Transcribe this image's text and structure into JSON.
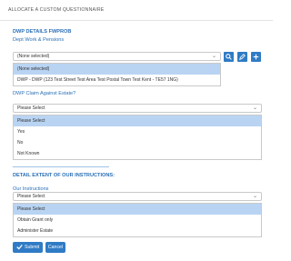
{
  "header": {
    "title": "ALLOCATE A CUSTOM QUESTIONNAIRE"
  },
  "dwp_details": {
    "title": "DWP DETAILS FWPROB",
    "label": "Dept Work & Pensions",
    "selected": "(None selected)",
    "options": [
      "(None selected)",
      "DWP - DWP (123 Test Street Test Area Test Postal Town Test Kent - TE57 1NG)"
    ],
    "actions": [
      "search-icon",
      "pencil-icon",
      "plus-icon"
    ]
  },
  "claim_against_estate": {
    "label": "DWP Claim Against Estate?",
    "selected": "Please Select",
    "options": [
      "Please Select",
      "Yes",
      "No",
      "Not Known"
    ]
  },
  "instructions": {
    "title": "DETAIL EXTENT OF OUR INSTRUCTIONS:",
    "label": "Our Instructions",
    "selected": "Please Select",
    "options": [
      "Please Select",
      "Obtain Grant only",
      "Administer Estate"
    ]
  },
  "buttons": {
    "submit": "Submit",
    "cancel": "Cancel"
  },
  "colors": {
    "accent": "#2f7bc5",
    "label": "#2a6fb6",
    "selected_option": "#b9d4f3"
  }
}
